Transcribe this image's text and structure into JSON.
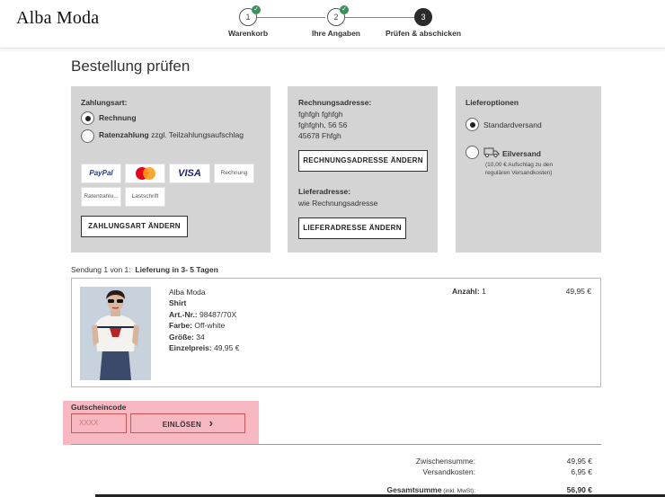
{
  "header": {
    "logo": "Alba Moda",
    "steps": [
      {
        "number": "1",
        "label": "Warenkorb",
        "done": true
      },
      {
        "number": "2",
        "label": "Ihre Angaben",
        "done": true
      },
      {
        "number": "3",
        "label": "Prüfen & abschicken",
        "done": false
      }
    ],
    "check_glyph": "✓"
  },
  "page_title": "Bestellung prüfen",
  "payment": {
    "title": "Zahlungsart:",
    "options": [
      {
        "label": "Rechnung",
        "note": "",
        "selected": true
      },
      {
        "label": "Ratenzahlung",
        "note": " zzgl. Teilzahlungsaufschlag",
        "selected": false
      }
    ],
    "methods": [
      "PayPal",
      "Mastercard",
      "VISA",
      "Rechnung",
      "Ratenzahlu...",
      "Lastschrift"
    ],
    "change_button": "ZAHLUNGSART ÄNDERN"
  },
  "billing": {
    "title": "Rechnungsadresse:",
    "lines": [
      "fghfgh fghfgh",
      "fghfghh, 56 56",
      "45678 Fhfgh"
    ],
    "change_button": "RECHNUNGSADRESSE ÄNDERN",
    "delivery_title": "Lieferadresse:",
    "delivery_value": "wie Rechnungsadresse",
    "delivery_button": "LIEFERADRESSE ÄNDERN"
  },
  "delivery_options": {
    "title": "Lieferoptionen",
    "standard": "Standardversand",
    "express": "Eilversand",
    "express_note_1": "(10,00 € Aufschlag zu den",
    "express_note_2": "regulären Versandkosten)",
    "selected": "standard"
  },
  "shipment": {
    "prefix": "Sendung 1 von 1:",
    "label": "Lieferung in 3- 5 Tagen"
  },
  "product": {
    "brand": "Alba Moda",
    "name": "Shirt",
    "art_label": "Art.-Nr.:",
    "art_value": " 98487/70X",
    "color_label": "Farbe:",
    "color_value": " Off-white",
    "size_label": "Größe:",
    "size_value": " 34",
    "unit_label": "Einzelpreis:",
    "unit_value": " 49,95 €",
    "qty_label": "Anzahl:",
    "qty_value": " 1",
    "price": "49,95 €"
  },
  "voucher": {
    "label": "Gutscheincode",
    "placeholder": "XXXX",
    "button": "EINLÖSEN",
    "chevron": "›"
  },
  "summary": {
    "subtotal_label": "Zwischensumme:",
    "subtotal_value": "49,95 €",
    "shipping_label": "Versandkosten:",
    "shipping_value": "6,95 €",
    "total_label": "Gesamtsumme",
    "total_note": " (inkl. MwSt):",
    "total_value": "56,90 €"
  }
}
